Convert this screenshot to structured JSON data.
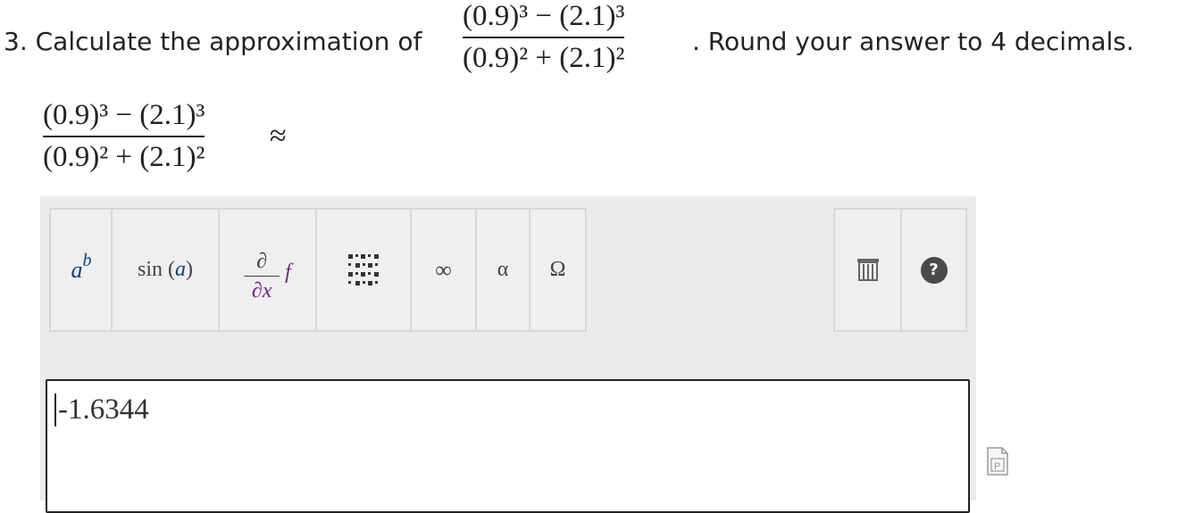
{
  "question": {
    "prefix": "3. Calculate the approximation of",
    "suffix": ". Round your answer to 4 decimals.",
    "numerator": "(0.9)³ − (2.1)³",
    "denominator": "(0.9)² + (2.1)²"
  },
  "answer_line": {
    "numerator": "(0.9)³ − (2.1)³",
    "denominator": "(0.9)² + (2.1)²",
    "approx_symbol": "≈"
  },
  "toolbar": {
    "power_base": "a",
    "power_exp": "b",
    "sin_fn": "sin",
    "sin_arg": "a",
    "partial_num": "∂",
    "partial_den": "∂x",
    "f_symbol": "f",
    "infinity": "∞",
    "alpha": "α",
    "omega": "Ω",
    "help": "?"
  },
  "answer": {
    "value": "-1.6344"
  },
  "colors": {
    "panel_bg": "#ebebeb",
    "button_border": "#d8d8d8",
    "var_blue": "#0b3a99",
    "fvar_purple": "#7a1f90",
    "help_dark": "#4a4a4a"
  }
}
